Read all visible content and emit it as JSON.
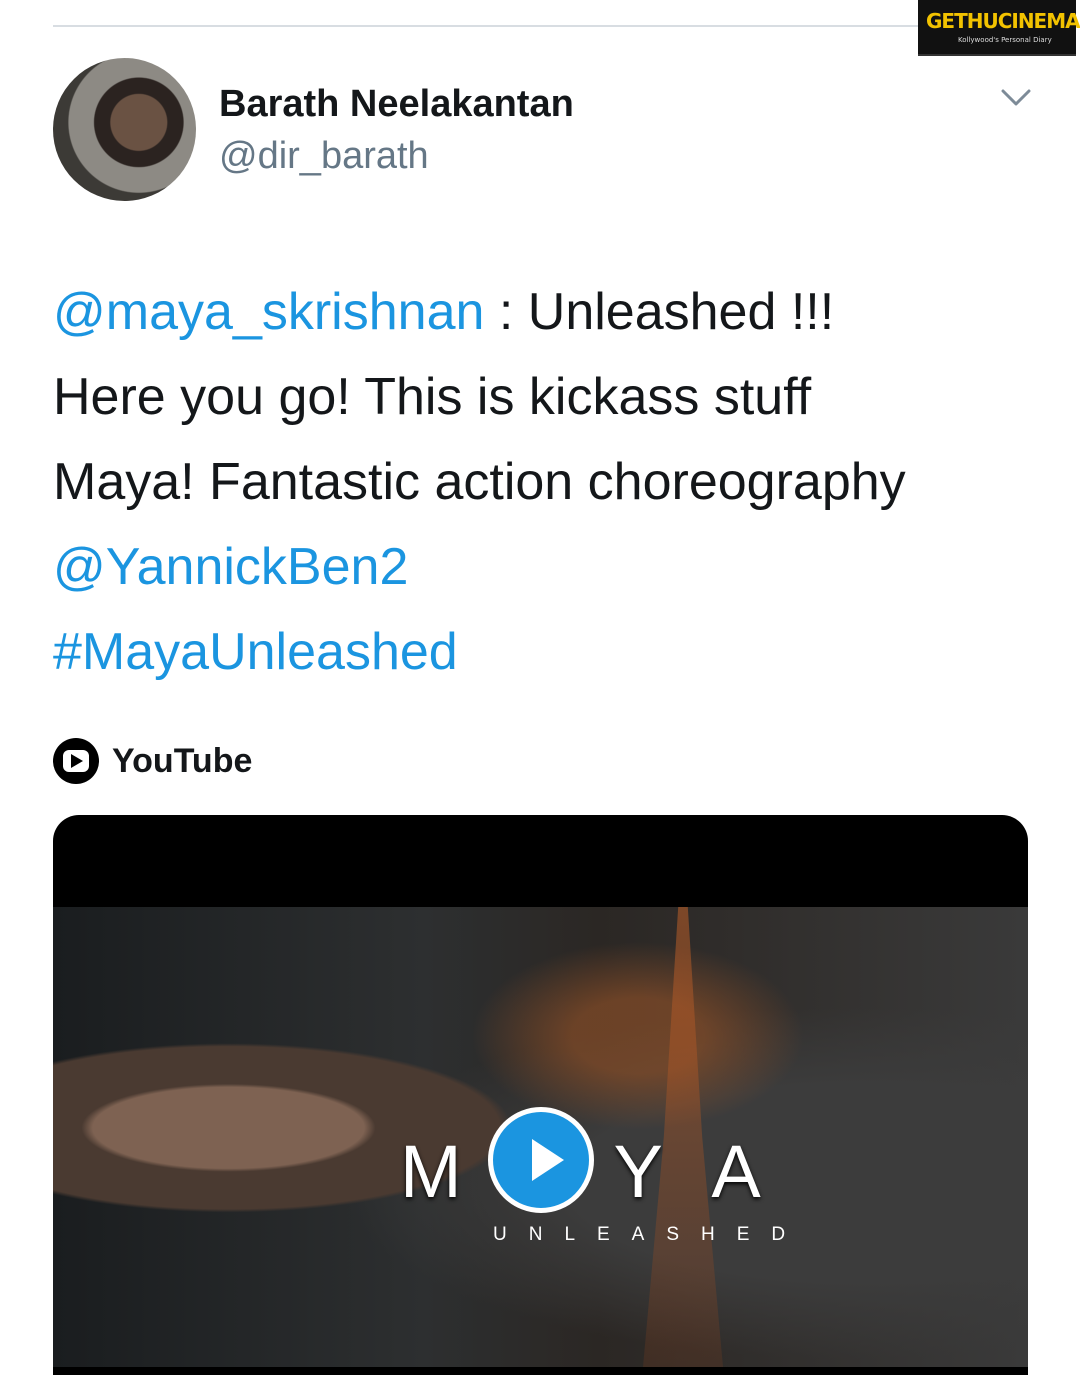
{
  "watermark": {
    "title": "GETHUCINEMA",
    "subtitle": "Kollywood's Personal Diary"
  },
  "author": {
    "name": "Barath Neelakantan",
    "handle": "@dir_barath"
  },
  "tweet": {
    "mention_1": "@maya_skrishnan",
    "text_1": " : Unleashed !!!",
    "text_2": "Here you go! This is kickass stuff",
    "text_3": "Maya! Fantastic action choreography",
    "mention_2": "@YannickBen2",
    "hashtag": "#MayaUnleashed"
  },
  "source": {
    "label": "YouTube",
    "icon": "youtube-icon"
  },
  "video": {
    "title": "MAYA",
    "subtitle": "UNLEASHED",
    "play_icon": "play-icon"
  },
  "colors": {
    "link": "#1b95e0",
    "watermark_accent": "#f2c200"
  }
}
